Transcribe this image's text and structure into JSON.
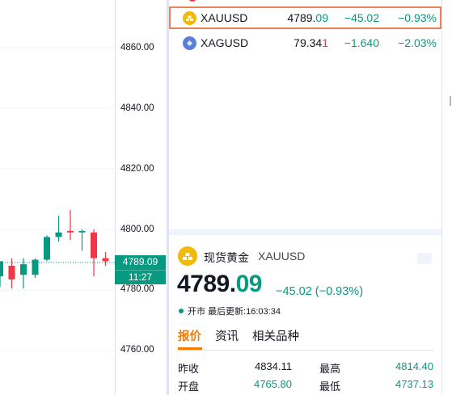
{
  "chart": {
    "price_labels": [
      "4860.00",
      "4840.00",
      "4820.00",
      "4800.00",
      "4780.00",
      "4760.00"
    ],
    "current_price_tag": "4789.09",
    "countdown_tag": "11:27",
    "colors": {
      "up": "#089981",
      "down": "#f23645",
      "grid": "#f0f3fa",
      "axis": "#e0e3eb"
    },
    "candles": [
      {
        "o": 4784.5,
        "h": 4787.5,
        "l": 4781.0,
        "c": 4789.5
      },
      {
        "o": 4788.0,
        "h": 4790.5,
        "l": 4780.5,
        "c": 4783.5
      },
      {
        "o": 4785.0,
        "h": 4790.5,
        "l": 4780.5,
        "c": 4788.5
      },
      {
        "o": 4785.0,
        "h": 4790.5,
        "l": 4784.0,
        "c": 4790.0
      },
      {
        "o": 4790.0,
        "h": 4798.0,
        "l": 4789.5,
        "c": 4797.5
      },
      {
        "o": 4797.5,
        "h": 4804.5,
        "l": 4796.0,
        "c": 4799.0
      },
      {
        "o": 4799.5,
        "h": 4806.5,
        "l": 4796.5,
        "c": 4799.0
      },
      {
        "o": 4799.0,
        "h": 4800.0,
        "l": 4793.0,
        "c": 4799.5
      },
      {
        "o": 4799.0,
        "h": 4800.0,
        "l": 4784.5,
        "c": 4790.5
      },
      {
        "o": 4790.5,
        "h": 4792.5,
        "l": 4788.0,
        "c": 4789.5
      }
    ]
  },
  "watchlist": {
    "rows": [
      {
        "symbol": "XAUUSD",
        "last_main": "4789.",
        "last_frac": "09",
        "change": "−45.02",
        "change_pct": "−0.93%",
        "icon": "gold-bars-icon",
        "icon_color": "#f0b90b"
      },
      {
        "symbol": "XAGUSD",
        "last_main": "79.34",
        "last_frac": "1",
        "change": "−1.640",
        "change_pct": "−2.03%",
        "icon": "silver-icon",
        "icon_color": "#5b7fd6"
      }
    ]
  },
  "details": {
    "name": "现货黄金",
    "symbol": "XAUUSD",
    "price_main": "4789.",
    "price_frac": "09",
    "change": "−45.02 (−0.93%)",
    "market_status": "开市",
    "last_update": "最后更新:16:03:34",
    "tabs": [
      "报价",
      "资讯",
      "相关品种"
    ],
    "stats": [
      {
        "label": "昨收",
        "value": "4834.11",
        "label2": "最高",
        "value2": "4814.40"
      },
      {
        "label": "开盘",
        "value": "4765.80",
        "label2": "最低",
        "value2": "4737.13"
      }
    ]
  }
}
